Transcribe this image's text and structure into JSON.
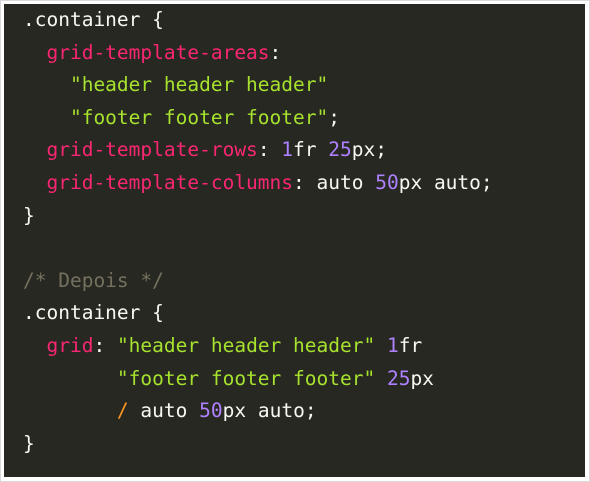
{
  "code": {
    "lines": [
      [
        {
          "t": ".container ",
          "k": "plain"
        },
        {
          "t": "{",
          "k": "brace"
        }
      ],
      [
        {
          "t": "  grid-template-areas",
          "k": "prop"
        },
        {
          "t": ":",
          "k": "punct"
        }
      ],
      [
        {
          "t": "    \"header header header\"",
          "k": "str"
        }
      ],
      [
        {
          "t": "    \"footer footer footer\"",
          "k": "str"
        },
        {
          "t": ";",
          "k": "punct"
        }
      ],
      [
        {
          "t": "  grid-template-rows",
          "k": "prop"
        },
        {
          "t": ": ",
          "k": "punct"
        },
        {
          "t": "1",
          "k": "num"
        },
        {
          "t": "fr ",
          "k": "unit"
        },
        {
          "t": "25",
          "k": "num"
        },
        {
          "t": "px",
          "k": "unit"
        },
        {
          "t": ";",
          "k": "punct"
        }
      ],
      [
        {
          "t": "  grid-template-columns",
          "k": "prop"
        },
        {
          "t": ": ",
          "k": "punct"
        },
        {
          "t": "auto ",
          "k": "plain"
        },
        {
          "t": "50",
          "k": "num"
        },
        {
          "t": "px ",
          "k": "unit"
        },
        {
          "t": "auto",
          "k": "plain"
        },
        {
          "t": ";",
          "k": "punct"
        }
      ],
      [
        {
          "t": "}",
          "k": "brace"
        }
      ],
      [
        {
          "t": "",
          "k": "plain"
        }
      ],
      [
        {
          "t": "/* Depois */",
          "k": "comment"
        }
      ],
      [
        {
          "t": ".container ",
          "k": "plain"
        },
        {
          "t": "{",
          "k": "brace"
        }
      ],
      [
        {
          "t": "  grid",
          "k": "prop"
        },
        {
          "t": ": ",
          "k": "punct"
        },
        {
          "t": "\"header header header\"",
          "k": "str"
        },
        {
          "t": " ",
          "k": "plain"
        },
        {
          "t": "1",
          "k": "num"
        },
        {
          "t": "fr",
          "k": "unit"
        }
      ],
      [
        {
          "t": "        \"footer footer footer\"",
          "k": "str"
        },
        {
          "t": " ",
          "k": "plain"
        },
        {
          "t": "25",
          "k": "num"
        },
        {
          "t": "px",
          "k": "unit"
        }
      ],
      [
        {
          "t": "        ",
          "k": "plain"
        },
        {
          "t": "/",
          "k": "op"
        },
        {
          "t": " auto ",
          "k": "plain"
        },
        {
          "t": "50",
          "k": "num"
        },
        {
          "t": "px ",
          "k": "unit"
        },
        {
          "t": "auto",
          "k": "plain"
        },
        {
          "t": ";",
          "k": "punct"
        }
      ],
      [
        {
          "t": "}",
          "k": "brace"
        }
      ]
    ]
  },
  "colors": {
    "background": "#272822",
    "property": "#f92672",
    "string": "#a6e22e",
    "number": "#ae81ff",
    "operator": "#fd971f",
    "comment": "#75715e",
    "text": "#f8f8f2"
  }
}
